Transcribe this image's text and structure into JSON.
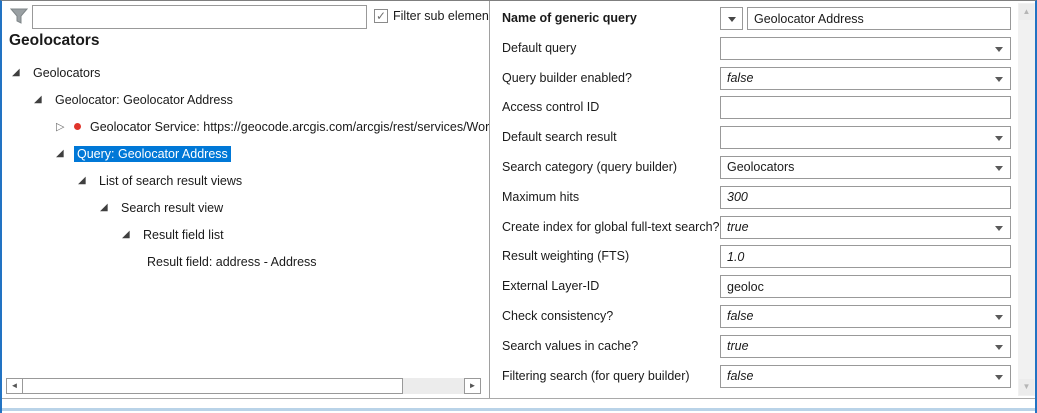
{
  "colors": {
    "selection": "#0078d7",
    "window_border": "#2273c3",
    "bottom_border": "#b9d3e8",
    "red_bullet": "#e0352b"
  },
  "left_panel": {
    "title": "Geolocators",
    "filter": {
      "input_value": "",
      "checkbox_checked": true,
      "checkbox_label": "Filter sub elements",
      "check_glyph": "✓"
    },
    "tree": [
      {
        "label": "Geolocators",
        "level": 0,
        "state": "expanded",
        "selected": false,
        "bullet": null
      },
      {
        "label": "Geolocator: Geolocator Address",
        "level": 1,
        "state": "expanded",
        "selected": false,
        "bullet": null
      },
      {
        "label": "Geolocator Service: https://geocode.arcgis.com/arcgis/rest/services/World/Geoc",
        "level": 2,
        "state": "collapsed",
        "selected": false,
        "bullet": "red"
      },
      {
        "label": "Query: Geolocator Address",
        "level": 2,
        "state": "expanded",
        "selected": true,
        "bullet": null
      },
      {
        "label": "List of search result views",
        "level": 3,
        "state": "expanded",
        "selected": false,
        "bullet": null
      },
      {
        "label": "Search result view",
        "level": 4,
        "state": "expanded",
        "selected": false,
        "bullet": null
      },
      {
        "label": "Result field list",
        "level": 5,
        "state": "expanded",
        "selected": false,
        "bullet": null
      },
      {
        "label": "Result field: address - Address",
        "level": 6,
        "state": "leaf",
        "selected": false,
        "bullet": null
      }
    ],
    "glyphs": {
      "expanded": "◢",
      "collapsed": "▷"
    },
    "h_scrollbar": {
      "left_arrow": "◄",
      "right_arrow": "►"
    }
  },
  "right_panel": {
    "rows": [
      {
        "label": "Name of generic query",
        "bold": true,
        "control": "combo-text",
        "value": "Geolocator Address",
        "italic": false
      },
      {
        "label": "Default query",
        "bold": false,
        "control": "select",
        "value": "",
        "italic": false
      },
      {
        "label": "Query builder enabled?",
        "bold": false,
        "control": "select",
        "value": "false",
        "italic": true
      },
      {
        "label": "Access control ID",
        "bold": false,
        "control": "text",
        "value": "",
        "italic": false
      },
      {
        "label": "Default search result",
        "bold": false,
        "control": "select",
        "value": "",
        "italic": false
      },
      {
        "label": "Search category (query builder)",
        "bold": false,
        "control": "select",
        "value": "Geolocators",
        "italic": false
      },
      {
        "label": "Maximum hits",
        "bold": false,
        "control": "text",
        "value": "300",
        "italic": true
      },
      {
        "label": "Create index for global full-text search?",
        "bold": false,
        "control": "select",
        "value": "true",
        "italic": true
      },
      {
        "label": "Result weighting (FTS)",
        "bold": false,
        "control": "text",
        "value": "1.0",
        "italic": true
      },
      {
        "label": "External Layer-ID",
        "bold": false,
        "control": "text",
        "value": "geoloc",
        "italic": false
      },
      {
        "label": "Check consistency?",
        "bold": false,
        "control": "select",
        "value": "false",
        "italic": true
      },
      {
        "label": "Search values in cache?",
        "bold": false,
        "control": "select",
        "value": "true",
        "italic": true
      },
      {
        "label": "Filtering search (for query builder)",
        "bold": false,
        "control": "select",
        "value": "false",
        "italic": true
      }
    ],
    "v_scrollbar": {
      "up_arrow": "▲",
      "down_arrow": "▼"
    }
  }
}
